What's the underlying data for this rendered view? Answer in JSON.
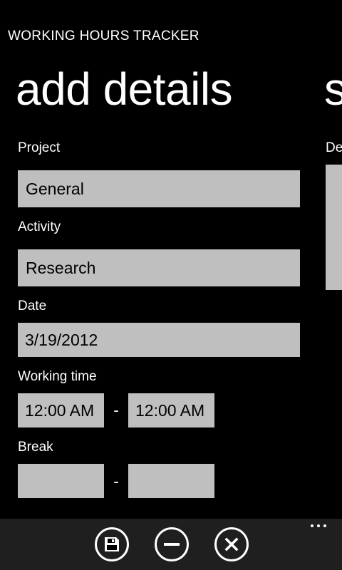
{
  "app": {
    "title": "WORKING HOURS TRACKER"
  },
  "page": {
    "title": "add details",
    "next_title_peek": "s"
  },
  "next_pivot": {
    "label_peek": "De"
  },
  "form": {
    "project": {
      "label": "Project",
      "value": "General"
    },
    "activity": {
      "label": "Activity",
      "value": "Research"
    },
    "date": {
      "label": "Date",
      "value": "3/19/2012"
    },
    "working_time": {
      "label": "Working time",
      "start": "12:00 AM",
      "separator": "-",
      "end": "12:00 AM"
    },
    "break": {
      "label": "Break",
      "start": "",
      "separator": "-",
      "end": ""
    }
  },
  "app_bar": {
    "buttons": [
      {
        "icon": "save-icon"
      },
      {
        "icon": "minus-icon"
      },
      {
        "icon": "close-icon"
      }
    ],
    "more_icon": "ellipsis-icon"
  },
  "colors": {
    "background": "#000000",
    "field_background": "#bfbfbf",
    "app_bar_background": "#1f1f1f",
    "foreground": "#ffffff"
  }
}
